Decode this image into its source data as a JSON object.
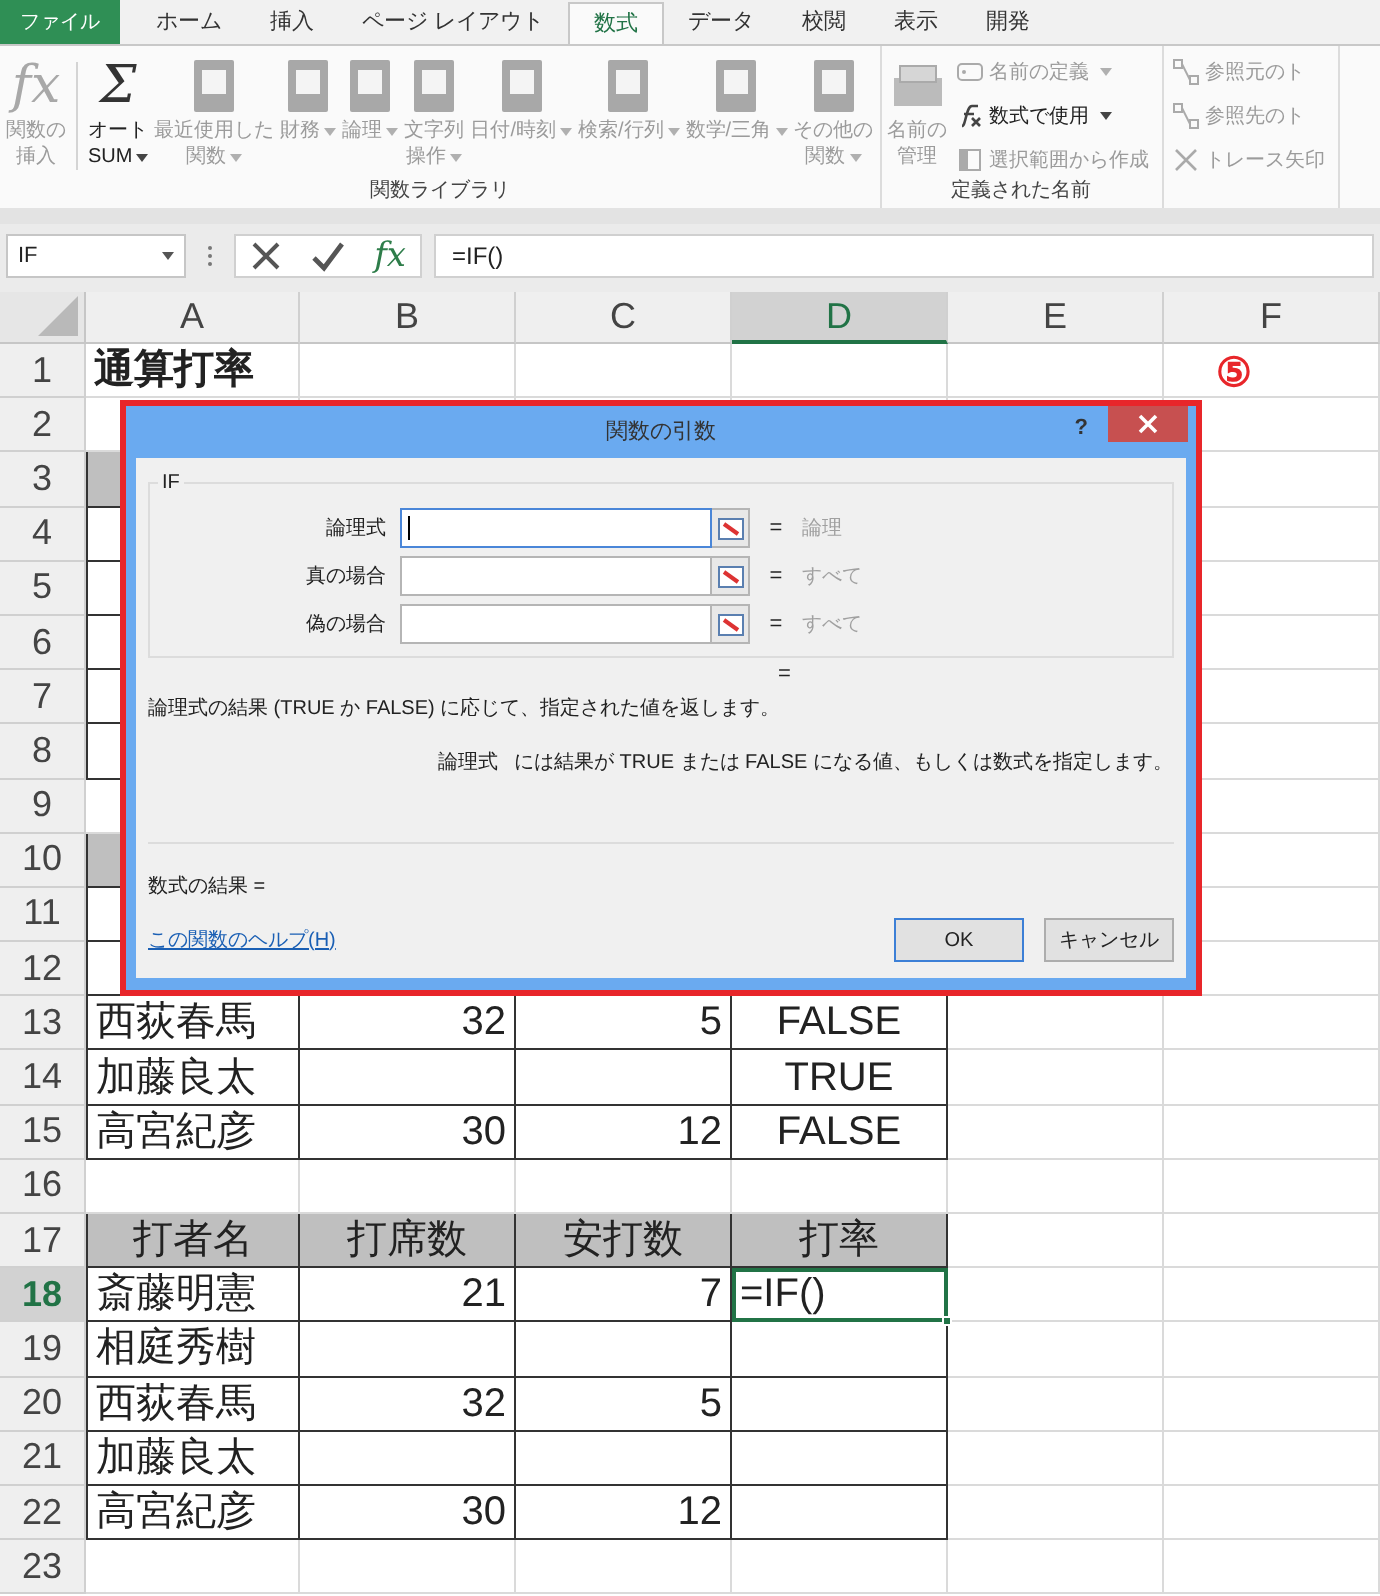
{
  "ribbon_tabs": [
    {
      "label": "ファイル",
      "kind": "file",
      "selected": false
    },
    {
      "label": "ホーム",
      "kind": "tab",
      "selected": false
    },
    {
      "label": "挿入",
      "kind": "tab",
      "selected": false
    },
    {
      "label": "ページ レイアウト",
      "kind": "tab",
      "selected": false
    },
    {
      "label": "数式",
      "kind": "tab",
      "selected": true
    },
    {
      "label": "データ",
      "kind": "tab",
      "selected": false
    },
    {
      "label": "校閲",
      "kind": "tab",
      "selected": false
    },
    {
      "label": "表示",
      "kind": "tab",
      "selected": false
    },
    {
      "label": "開発",
      "kind": "tab",
      "selected": false
    }
  ],
  "ribbon_groups": [
    {
      "label": "関数ライブラリ",
      "items": [
        {
          "kind": "glyph",
          "glyph": "fx",
          "lines": [
            "関数の",
            "挿入"
          ],
          "dropdown": false,
          "disabled": true
        },
        {
          "kind": "glyph",
          "glyph": "Σ",
          "lines": [
            "オート",
            "SUM"
          ],
          "dropdown": true,
          "disabled": false
        },
        {
          "kind": "book",
          "lines": [
            "最近使用した",
            "関数"
          ],
          "dropdown": true,
          "disabled": true
        },
        {
          "kind": "book",
          "lines": [
            "財務"
          ],
          "dropdown": true,
          "disabled": true
        },
        {
          "kind": "book",
          "lines": [
            "論理"
          ],
          "dropdown": true,
          "disabled": true
        },
        {
          "kind": "book",
          "lines": [
            "文字列",
            "操作"
          ],
          "dropdown": true,
          "disabled": true
        },
        {
          "kind": "book",
          "lines": [
            "日付/時刻"
          ],
          "dropdown": true,
          "disabled": true
        },
        {
          "kind": "book",
          "lines": [
            "検索/行列"
          ],
          "dropdown": true,
          "disabled": true
        },
        {
          "kind": "book",
          "lines": [
            "数学/三角"
          ],
          "dropdown": true,
          "disabled": true
        },
        {
          "kind": "book",
          "lines": [
            "その他の",
            "関数"
          ],
          "dropdown": true,
          "disabled": true
        }
      ]
    },
    {
      "label": "定義された名前",
      "items": [
        {
          "kind": "manager",
          "lines": [
            "名前の",
            "管理"
          ],
          "dropdown": false,
          "disabled": true
        },
        {
          "kind": "small",
          "label": "名前の定義",
          "dropdown": true,
          "disabled": true
        },
        {
          "kind": "small",
          "label": "数式で使用",
          "dropdown": true,
          "disabled": false
        },
        {
          "kind": "small",
          "label": "選択範囲から作成",
          "dropdown": false,
          "disabled": true
        }
      ]
    },
    {
      "items": [
        {
          "kind": "small",
          "label": "参照元のト",
          "dropdown": false,
          "disabled": true
        },
        {
          "kind": "small",
          "label": "参照先のト",
          "dropdown": false,
          "disabled": true
        },
        {
          "kind": "small",
          "label": "トレース矢印",
          "dropdown": false,
          "disabled": true
        }
      ]
    }
  ],
  "formula_bar": {
    "name_box": "IF",
    "insert_function": "fx",
    "formula": "=IF()"
  },
  "sheet": {
    "columns": [
      {
        "label": "A",
        "selected": false
      },
      {
        "label": "B",
        "selected": false
      },
      {
        "label": "C",
        "selected": false
      },
      {
        "label": "D",
        "selected": true
      },
      {
        "label": "E",
        "selected": false
      },
      {
        "label": "F",
        "selected": false
      }
    ],
    "annotation": "⑤",
    "rows": [
      {
        "number": "1",
        "kind": "title",
        "selected": false,
        "cells": [
          {
            "text": "通算打率",
            "kind": "text"
          }
        ]
      },
      {
        "number": "2",
        "kind": "plain",
        "selected": false
      },
      {
        "number": "3",
        "kind": "header",
        "selected": false
      },
      {
        "number": "4",
        "kind": "data",
        "selected": false
      },
      {
        "number": "5",
        "kind": "data",
        "selected": false
      },
      {
        "number": "6",
        "kind": "data",
        "selected": false
      },
      {
        "number": "7",
        "kind": "data",
        "selected": false
      },
      {
        "number": "8",
        "kind": "data",
        "selected": false
      },
      {
        "number": "9",
        "kind": "plain",
        "selected": false
      },
      {
        "number": "10",
        "kind": "header",
        "selected": false
      },
      {
        "number": "11",
        "kind": "data",
        "selected": false
      },
      {
        "number": "12",
        "kind": "data",
        "selected": false
      },
      {
        "number": "13",
        "kind": "data",
        "selected": false,
        "cells": [
          {
            "text": "西荻春馬",
            "kind": "text"
          },
          {
            "text": "32",
            "kind": "number"
          },
          {
            "text": "5",
            "kind": "number"
          },
          {
            "text": "FALSE",
            "kind": "bool"
          }
        ]
      },
      {
        "number": "14",
        "kind": "data",
        "selected": false,
        "cells": [
          {
            "text": "加藤良太",
            "kind": "text"
          },
          {
            "kind": "empty"
          },
          {
            "kind": "empty"
          },
          {
            "text": "TRUE",
            "kind": "bool"
          }
        ]
      },
      {
        "number": "15",
        "kind": "data",
        "selected": false,
        "cells": [
          {
            "text": "高宮紀彦",
            "kind": "text"
          },
          {
            "text": "30",
            "kind": "number"
          },
          {
            "text": "12",
            "kind": "number"
          },
          {
            "text": "FALSE",
            "kind": "bool"
          }
        ]
      },
      {
        "number": "16",
        "kind": "plain",
        "selected": false
      },
      {
        "number": "17",
        "kind": "header",
        "selected": false,
        "cells": [
          {
            "text": "打者名",
            "kind": "bool"
          },
          {
            "text": "打席数",
            "kind": "bool"
          },
          {
            "text": "安打数",
            "kind": "bool"
          },
          {
            "text": "打率",
            "kind": "bool"
          }
        ]
      },
      {
        "number": "18",
        "kind": "data",
        "selected": true,
        "cells": [
          {
            "text": "斎藤明憲",
            "kind": "text"
          },
          {
            "text": "21",
            "kind": "number"
          },
          {
            "text": "7",
            "kind": "number"
          },
          {
            "text": "=IF()",
            "kind": "formula"
          }
        ]
      },
      {
        "number": "19",
        "kind": "data",
        "selected": false,
        "cells": [
          {
            "text": "相庭秀樹",
            "kind": "text"
          }
        ]
      },
      {
        "number": "20",
        "kind": "data",
        "selected": false,
        "cells": [
          {
            "text": "西荻春馬",
            "kind": "text"
          },
          {
            "text": "32",
            "kind": "number"
          },
          {
            "text": "5",
            "kind": "number"
          }
        ]
      },
      {
        "number": "21",
        "kind": "data",
        "selected": false,
        "cells": [
          {
            "text": "加藤良太",
            "kind": "text"
          }
        ]
      },
      {
        "number": "22",
        "kind": "data",
        "selected": false,
        "cells": [
          {
            "text": "高宮紀彦",
            "kind": "text"
          },
          {
            "text": "30",
            "kind": "number"
          },
          {
            "text": "12",
            "kind": "number"
          }
        ]
      },
      {
        "number": "23",
        "kind": "plain",
        "selected": false
      }
    ]
  },
  "dialog": {
    "title": "関数の引数",
    "help": "?",
    "function_name": "IF",
    "arguments": [
      {
        "label": "論理式",
        "equals": "=",
        "hint": "論理",
        "focused": true
      },
      {
        "label": "真の場合",
        "equals": "=",
        "hint": "すべて",
        "focused": false
      },
      {
        "label": "偽の場合",
        "equals": "=",
        "hint": "すべて",
        "focused": false
      }
    ],
    "result_equals": "=",
    "description": "論理式の結果 (TRUE か FALSE) に応じて、指定された値を返します。",
    "argument_name": "論理式",
    "argument_help": "には結果が TRUE または FALSE になる値、もしくは数式を指定します。",
    "formula_result": "数式の結果 =",
    "help_link": "この関数のヘルプ(H)",
    "buttons": [
      {
        "label": "OK",
        "default": true
      },
      {
        "label": "キャンセル",
        "default": false
      }
    ]
  }
}
